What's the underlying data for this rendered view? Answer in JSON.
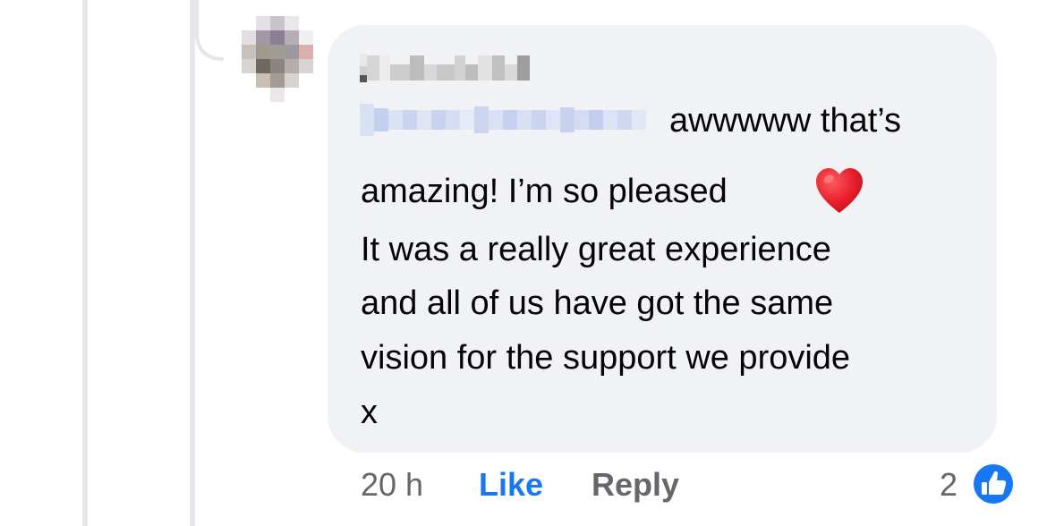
{
  "comment": {
    "author_name": "[redacted]",
    "mention": "[redacted]",
    "lines": [
      "awwwww that’s",
      "amazing! I’m so pleased",
      "It was a really great experience",
      "and all of us have got the same",
      "vision for the support we provide",
      "x"
    ],
    "emoji": "red-heart-icon"
  },
  "actions": {
    "timestamp": "20 h",
    "like_label": "Like",
    "reply_label": "Reply",
    "reaction_count": "2",
    "reaction_icon": "thumbs-up-icon"
  },
  "colors": {
    "bubble": "#f0f2f5",
    "thread_line": "#e4e6eb",
    "text": "#050505",
    "muted": "#65676b",
    "accent": "#1877f2",
    "heart": "#e0202f"
  }
}
